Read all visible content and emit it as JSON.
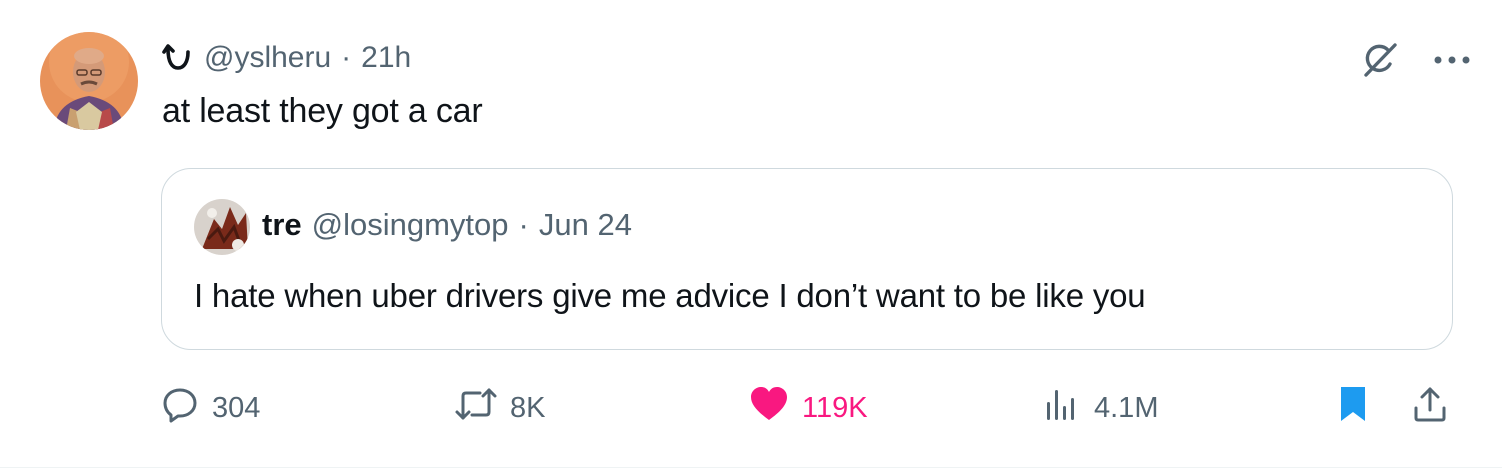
{
  "tweet": {
    "handle": "@yslheru",
    "separator": "·",
    "time": "21h",
    "text": "at least they got a car"
  },
  "quote": {
    "name": "tre",
    "handle": "@losingmytop",
    "separator": "·",
    "date": "Jun 24",
    "text": "I hate when uber drivers give me advice I don’t want to be like you"
  },
  "actions": {
    "replies": "304",
    "reposts": "8K",
    "likes": "119K",
    "views": "4.1M"
  },
  "colors": {
    "like": "#f91880",
    "bookmark": "#1d9bf0",
    "secondary_text": "#536471",
    "border": "#cfd9de"
  },
  "icons": [
    "reply-icon",
    "repost-icon",
    "heart-icon",
    "views-icon",
    "bookmark-icon",
    "share-icon",
    "grok-icon",
    "more-icon",
    "handle-symbol-icon"
  ]
}
